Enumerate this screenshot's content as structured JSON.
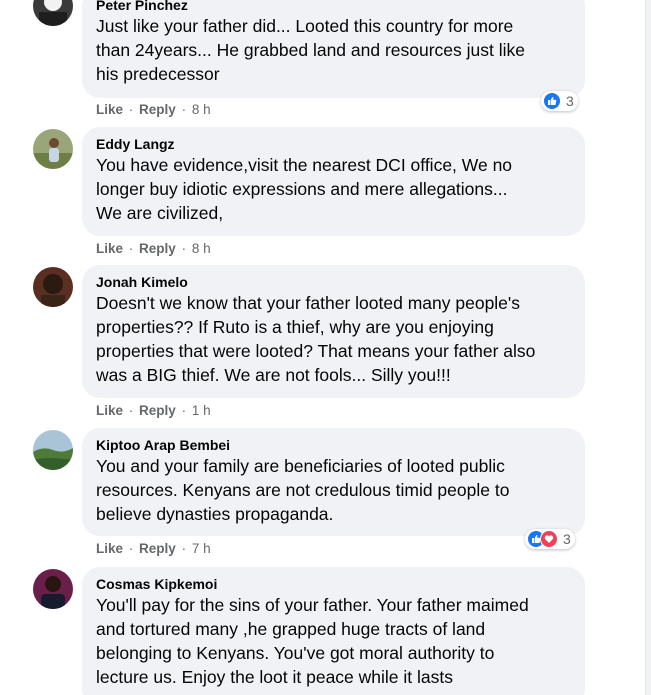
{
  "comments": [
    {
      "author": "Peter Pinchez",
      "text": "Just like your father did... Looted this country for more\nthan 24years... He grabbed land and resources just like\nhis predecessor",
      "actions": {
        "like": "Like",
        "reply": "Reply",
        "time": "8 h"
      },
      "reaction_count": "3",
      "reactions": [
        "like"
      ]
    },
    {
      "author": "Eddy Langz",
      "text": "You have evidence,visit the nearest DCI office, We no\nlonger buy idiotic expressions and mere allegations...\nWe are civilized,",
      "actions": {
        "like": "Like",
        "reply": "Reply",
        "time": "8 h"
      }
    },
    {
      "author": "Jonah Kimelo",
      "text": "Doesn't we know that your father looted many people's\nproperties?? If Ruto is a thief, why are you enjoying\nproperties that were looted? That means your father also\nwas a BIG thief. We are not fools... Silly you!!!",
      "actions": {
        "like": "Like",
        "reply": "Reply",
        "time": "1 h"
      }
    },
    {
      "author": "Kiptoo Arap Bembei",
      "text": "You and your family are beneficiaries of looted public\nresources. Kenyans are not credulous timid people to\nbelieve dynasties propaganda.",
      "actions": {
        "like": "Like",
        "reply": "Reply",
        "time": "7 h"
      },
      "reaction_count": "3",
      "reactions": [
        "like",
        "love"
      ]
    },
    {
      "author": "Cosmas Kipkemoi",
      "text": "You'll pay for the sins of your father. Your father maimed\nand tortured many ,he grapped huge tracts of land\nbelonging to Kenyans. You've got moral authority to\nlecture us. Enjoy the loot it peace while it lasts"
    }
  ],
  "separator": "·",
  "colors": {
    "bubble": "#f0f2f5",
    "meta": "#65676b",
    "like": "#1877f2",
    "love": "#f33e58"
  },
  "icons": [
    "like-reaction-icon",
    "love-reaction-icon"
  ]
}
